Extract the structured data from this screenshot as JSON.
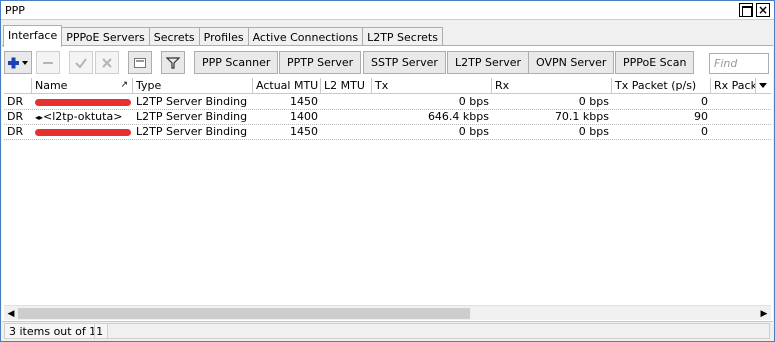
{
  "window": {
    "title": "PPP"
  },
  "tabs": [
    "Interface",
    "PPPoE Servers",
    "Secrets",
    "Profiles",
    "Active Connections",
    "L2TP Secrets"
  ],
  "toolbar": {
    "icons": [
      "plus-dropdown-icon",
      "minus-icon",
      "check-icon",
      "cross-icon",
      "comment-icon",
      "filter-icon"
    ],
    "buttons": [
      "PPP Scanner",
      "PPTP Server",
      "SSTP Server",
      "L2TP Server",
      "OVPN Server",
      "PPPoE Scan"
    ],
    "find_placeholder": "Find"
  },
  "table": {
    "columns": [
      "",
      "Name",
      "Type",
      "Actual MTU",
      "L2 MTU",
      "Tx",
      "Rx",
      "Tx Packet (p/s)",
      "Rx Pack"
    ],
    "rows": [
      {
        "flags": "DR",
        "name": "",
        "name_redacted": true,
        "type": "L2TP Server Binding",
        "actual_mtu": "1450",
        "l2_mtu": "",
        "tx": "0 bps",
        "rx": "0 bps",
        "tx_packet": "0"
      },
      {
        "flags": "DR",
        "name": "<l2tp-oktuta>",
        "name_redacted": false,
        "type": "L2TP Server Binding",
        "actual_mtu": "1400",
        "l2_mtu": "",
        "tx": "646.4 kbps",
        "rx": "70.1 kbps",
        "tx_packet": "90"
      },
      {
        "flags": "DR",
        "name": "",
        "name_redacted": true,
        "type": "L2TP Server Binding",
        "actual_mtu": "1450",
        "l2_mtu": "",
        "tx": "0 bps",
        "rx": "0 bps",
        "tx_packet": "0"
      }
    ]
  },
  "status": {
    "text": "3 items out of 11"
  }
}
